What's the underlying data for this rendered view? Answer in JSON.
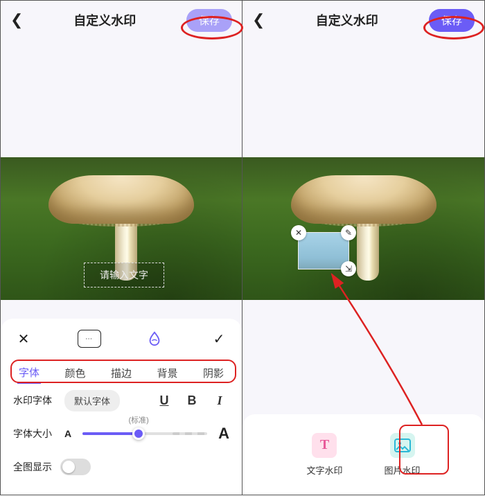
{
  "left": {
    "title": "自定义水印",
    "save": "保存",
    "placeholder": "请输入文字",
    "tabs": [
      "字体",
      "颜色",
      "描边",
      "背景",
      "阴影"
    ],
    "font_label": "水印字体",
    "font_value": "默认字体",
    "size_label": "字体大小",
    "size_tick": "(标准)",
    "full_label": "全图显示"
  },
  "right": {
    "title": "自定义水印",
    "save": "保存",
    "opt_text": "文字水印",
    "opt_image": "图片水印"
  }
}
